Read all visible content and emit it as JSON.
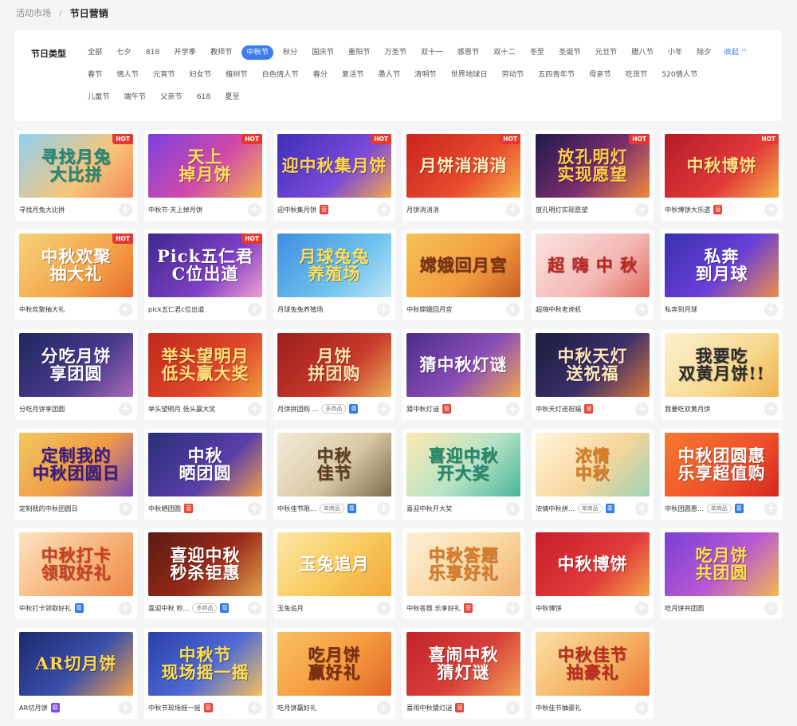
{
  "breadcrumb": {
    "parent": "活动市场",
    "separator": "/",
    "current": "节日营销"
  },
  "filter": {
    "label": "节日类型",
    "rows": [
      [
        "全部",
        "七夕",
        "818",
        "开学季",
        "教师节",
        "中秋节",
        "秋分",
        "国庆节",
        "重阳节",
        "万圣节",
        "双十一",
        "感恩节",
        "双十二",
        "冬至",
        "圣诞节",
        "元旦节",
        "腊八节",
        "小年",
        "除夕"
      ],
      [
        "春节",
        "情人节",
        "元宵节",
        "妇女节",
        "植树节",
        "白色情人节",
        "春分",
        "复活节",
        "愚人节",
        "清明节",
        "世界地球日",
        "劳动节",
        "五四青年节",
        "母亲节",
        "吃货节",
        "520情人节"
      ],
      [
        "儿童节",
        "端午节",
        "父亲节",
        "618",
        "夏至"
      ]
    ],
    "active": "中秋节",
    "collapse_label": "收起 ^"
  },
  "badge_styles": {
    "营": "#e9463a",
    "尊": "#2d7cf0",
    "联": "#7a4ee8"
  },
  "cards": [
    {
      "title": "寻找月兔\n大比拼",
      "caption": "寻找月兔大比拼",
      "hot": true,
      "bg": "linear-gradient(135deg,#8fd0f2 0%,#f6c67a 60%,#f48a5c 100%)",
      "color": "#1f8a7a"
    },
    {
      "title": "天上\n掉月饼",
      "caption": "中秋节·天上掉月饼",
      "hot": true,
      "bg": "linear-gradient(135deg,#7a3fe0 0%,#d24aa8 55%,#f3b44f 100%)",
      "color": "#ffe35a"
    },
    {
      "title": "迎中秋集月饼",
      "caption": "迎中秋集月饼",
      "badge": "营",
      "hot": true,
      "bg": "linear-gradient(135deg,#3d2fb8 0%,#7b4ad8 60%,#f2a64e 100%)",
      "color": "#ffd84a"
    },
    {
      "title": "月饼消消消",
      "caption": "月饼消消消",
      "hot": true,
      "bg": "linear-gradient(135deg,#c8251e 0%,#e84b2e 60%,#f7b54b 100%)",
      "color": "#fff3c2"
    },
    {
      "title": "放孔明灯\n实现愿望",
      "caption": "放孔明灯实现愿望",
      "hot": true,
      "bg": "linear-gradient(135deg,#1e1a4a 0%,#7b2d6e 55%,#f28b3a 100%)",
      "color": "#ffcf4a"
    },
    {
      "title": "中秋博饼",
      "caption": "中秋博饼大乐透",
      "badge": "营",
      "hot": true,
      "bg": "linear-gradient(135deg,#b51a27 0%,#e03a3a 60%,#f5b248 100%)",
      "color": "#ffe083"
    },
    {
      "title": "中秋欢聚\n抽大礼",
      "caption": "中秋欢聚抽大礼",
      "hot": true,
      "bg": "linear-gradient(135deg,#f6d37a 0%,#f4a349 60%,#e96d2e 100%)",
      "color": "#ffffff"
    },
    {
      "title": "Pick五仁君\nC位出道",
      "caption": "pick五仁君c位出道",
      "hot": true,
      "bg": "linear-gradient(135deg,#3b2a8c 0%,#7f3fc6 60%,#f0a0d0 100%)",
      "color": "#ffffff"
    },
    {
      "title": "月球兔兔\n养殖场",
      "caption": "月球兔兔养殖场",
      "bg": "linear-gradient(135deg,#3f8de0 0%,#6fc3ee 60%,#bde6f5 100%)",
      "color": "#ffe05a"
    },
    {
      "title": "嫦娥回月宫",
      "caption": "中秋嫦娥回月宫",
      "bg": "linear-gradient(135deg,#f5c35a 0%,#f29a3e 60%,#c65b25 100%)",
      "color": "#7a2f10"
    },
    {
      "title": "超 嗨 中 秋",
      "caption": "超嗨中秋老虎机",
      "bg": "linear-gradient(135deg,#fbe3e0 0%,#f4b7b3 60%,#e26d5f 100%)",
      "color": "#c0241d"
    },
    {
      "title": "私奔\n到月球",
      "caption": "私奔到月球",
      "bg": "linear-gradient(135deg,#3a2fb0 0%,#6a3fd6 55%,#f08f4a 100%)",
      "color": "#ffffff"
    },
    {
      "title": "分吃月饼\n享团圆",
      "caption": "分吃月饼享团圆",
      "bg": "linear-gradient(135deg,#1f2860 0%,#4c3a8f 60%,#a96bb5 100%)",
      "color": "#ffffff"
    },
    {
      "title": "举头望明月\n低头赢大奖",
      "caption": "举头望明月 低头赢大奖",
      "bg": "linear-gradient(135deg,#c0291b 0%,#e0462b 60%,#f29a3c 100%)",
      "color": "#ffe07a"
    },
    {
      "title": "月饼\n拼团购",
      "caption": "月饼拼团购 ...",
      "badge": "尊",
      "chip": "多商品",
      "bg": "linear-gradient(135deg,#9c1f1f 0%,#c93a2a 60%,#e9b05c 100%)",
      "color": "#ffe7b0"
    },
    {
      "title": "猜中秋灯谜",
      "caption": "猜中秋灯谜",
      "badge": "营",
      "bg": "linear-gradient(135deg,#4a2d8c 0%,#8a4db8 55%,#f1a84c 100%)",
      "color": "#ffffff"
    },
    {
      "title": "中秋天灯\n送祝福",
      "caption": "中秋天灯送祝福",
      "badge": "营",
      "bg": "linear-gradient(135deg,#1a1d3e 0%,#3b2f6a 55%,#d8773a 100%)",
      "color": "#ffe8b8"
    },
    {
      "title": "我要吃\n双黄月饼!!",
      "caption": "我要吃双黄月饼",
      "bg": "linear-gradient(135deg,#fdf1d2 0%,#f7d98e 60%,#f0b250 100%)",
      "color": "#2b2b2b"
    },
    {
      "title": "定制我的\n中秋团圆日",
      "caption": "定制我的中秋团圆日",
      "bg": "linear-gradient(135deg,#f2c860 0%,#f09a45 55%,#7b4ab8 100%)",
      "color": "#3a1a8a"
    },
    {
      "title": "中秋\n晒团圆",
      "caption": "中秋晒团圆",
      "badge": "营",
      "bg": "linear-gradient(135deg,#2a2f7a 0%,#5a3ea8 60%,#f1a14a 100%)",
      "color": "#ffffff"
    },
    {
      "title": "中秋\n佳节",
      "caption": "中秋佳节限...",
      "badge": "尊",
      "chip": "单商品",
      "bg": "linear-gradient(135deg,#f4ecd9 0%,#d9c9a6 55%,#7c6a4d 100%)",
      "color": "#5b3b1e"
    },
    {
      "title": "喜迎中秋\n开大奖",
      "caption": "喜迎中秋开大奖",
      "bg": "linear-gradient(135deg,#fde8b2 0%,#b6e3c6 55%,#48b59a 100%)",
      "color": "#1d8a6a"
    },
    {
      "title": "浓情\n中秋",
      "caption": "浓情中秋拼...",
      "badge": "尊",
      "chip": "单商品",
      "bg": "linear-gradient(135deg,#fff5dc 0%,#f6d69a 55%,#9cd3b6 100%)",
      "color": "#e07a1f"
    },
    {
      "title": "中秋团圆惠\n乐享超值购",
      "caption": "中秋团圆惠...",
      "badge": "尊",
      "chip": "单商品",
      "bg": "linear-gradient(135deg,#f57a2f 0%,#ee4f2b 60%,#d4281f 100%)",
      "color": "#ffffff"
    },
    {
      "title": "中秋打卡\n领取好礼",
      "caption": "中秋打卡领取好礼",
      "badge": "尊",
      "bg": "linear-gradient(135deg,#fde3c0 0%,#f7b37a 55%,#f08a4a 100%)",
      "color": "#d33c1e"
    },
    {
      "title": "喜迎中秋\n秒杀钜惠",
      "caption": "喜迎中秋 秒...",
      "badge": "尊",
      "chip": "多商品",
      "bg": "linear-gradient(135deg,#5a1a12 0%,#9a2a1a 55%,#e0a050 100%)",
      "color": "#ffffff"
    },
    {
      "title": "玉兔追月",
      "caption": "玉兔追月",
      "bg": "linear-gradient(135deg,#fde7a8 0%,#f8c95c 55%,#f2a73a 100%)",
      "color": "#ffffff"
    },
    {
      "title": "中秋答题\n乐享好礼",
      "caption": "中秋答题 乐享好礼",
      "badge": "营",
      "bg": "linear-gradient(135deg,#fdf0d6 0%,#f9d8a3 55%,#f3b474 100%)",
      "color": "#e07a1f"
    },
    {
      "title": "中秋博饼",
      "caption": "中秋博饼",
      "bg": "linear-gradient(135deg,#c81d2a 0%,#e13b3b 60%,#f4a34a 100%)",
      "color": "#ffffff"
    },
    {
      "title": "吃月饼\n共团圆",
      "caption": "吃月饼共团圆",
      "bg": "linear-gradient(135deg,#7a3fd6 0%,#b85ad2 55%,#f5b84e 100%)",
      "color": "#ffe24a"
    },
    {
      "title": "AR切月饼",
      "caption": "AR切月饼",
      "badge": "联",
      "bg": "linear-gradient(135deg,#1e2a70 0%,#3a4fa8 55%,#f2a24c 100%)",
      "color": "#ffd84a"
    },
    {
      "title": "中秋节\n现场摇一摇",
      "caption": "中秋节现场摇一摇",
      "badge": "营",
      "bg": "linear-gradient(135deg,#2a3fa8 0%,#4f6ad6 55%,#f6c25a 100%)",
      "color": "#ffe04a"
    },
    {
      "title": "吃月饼\n赢好礼",
      "caption": "吃月饼赢好礼",
      "bg": "linear-gradient(135deg,#f8c260 0%,#f59a3e 55%,#e0652a 100%)",
      "color": "#7a2a10"
    },
    {
      "title": "喜闹中秋\n猜灯谜",
      "caption": "喜闹中秋猜灯谜",
      "badge": "营",
      "bg": "linear-gradient(135deg,#c2232a 0%,#d8403a 55%,#f3a456 100%)",
      "color": "#ffffff"
    },
    {
      "title": "中秋佳节\n抽豪礼",
      "caption": "中秋佳节抽豪礼",
      "bg": "linear-gradient(135deg,#fbe0a8 0%,#f6b464 55%,#ef7a3a 100%)",
      "color": "#c0291b"
    }
  ],
  "ui": {
    "hot_label": "HOT",
    "add_symbol": "+"
  }
}
